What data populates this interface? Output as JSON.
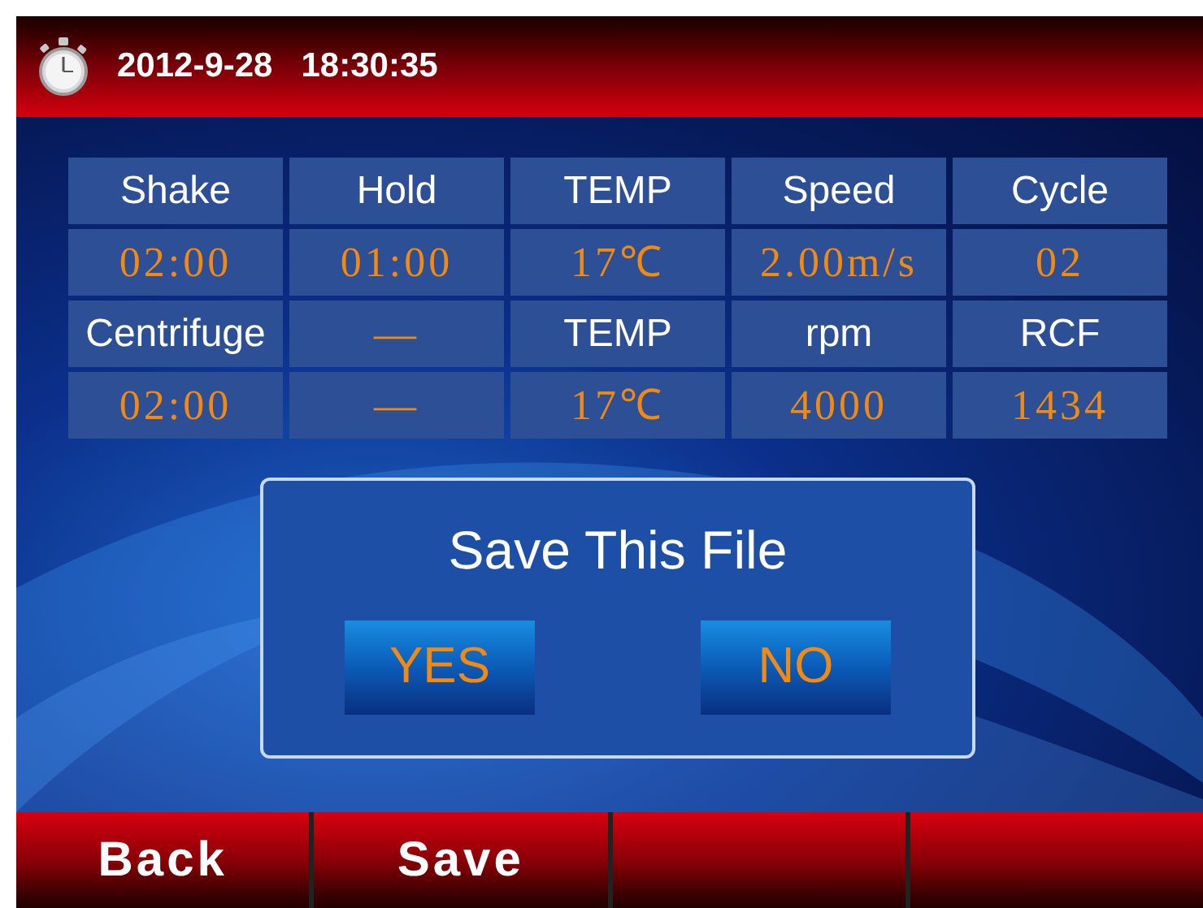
{
  "header": {
    "datetime": "2012-9-28   18:30:35"
  },
  "table": {
    "rows": [
      [
        {
          "text": "Shake",
          "kind": "label"
        },
        {
          "text": "Hold",
          "kind": "label"
        },
        {
          "text": "TEMP",
          "kind": "label"
        },
        {
          "text": "Speed",
          "kind": "label"
        },
        {
          "text": "Cycle",
          "kind": "label"
        }
      ],
      [
        {
          "text": "02:00",
          "kind": "value"
        },
        {
          "text": "01:00",
          "kind": "value"
        },
        {
          "text": "17℃",
          "kind": "value"
        },
        {
          "text": "2.00m/s",
          "kind": "value"
        },
        {
          "text": "02",
          "kind": "value"
        }
      ],
      [
        {
          "text": "Centrifuge",
          "kind": "label"
        },
        {
          "text": "—",
          "kind": "value"
        },
        {
          "text": "TEMP",
          "kind": "label"
        },
        {
          "text": "rpm",
          "kind": "label"
        },
        {
          "text": "RCF",
          "kind": "label"
        }
      ],
      [
        {
          "text": "02:00",
          "kind": "value"
        },
        {
          "text": "—",
          "kind": "value"
        },
        {
          "text": "17℃",
          "kind": "value"
        },
        {
          "text": "4000",
          "kind": "value"
        },
        {
          "text": "1434",
          "kind": "value"
        }
      ]
    ]
  },
  "dialog": {
    "title": "Save This File",
    "buttons": [
      "YES",
      "NO"
    ]
  },
  "footer": {
    "buttons": [
      {
        "kind": "text",
        "label": "Back"
      },
      {
        "kind": "text",
        "label": "Save"
      },
      {
        "kind": "blank"
      },
      {
        "kind": "blank"
      }
    ]
  }
}
